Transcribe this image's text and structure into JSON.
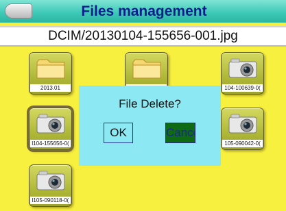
{
  "header": {
    "title": "Files management",
    "back_icon": "back-arrow-icon"
  },
  "path": {
    "text": "DCIM/20130104-155656-001.jpg"
  },
  "tiles": [
    {
      "label": "2013.01",
      "icon": "folder-icon"
    },
    {
      "label": "",
      "icon": "folder-icon"
    },
    {
      "label": "104-100639-0(",
      "icon": "camera-icon"
    },
    {
      "label": "l104-155656-0(",
      "icon": "camera-icon"
    },
    {
      "label": "105-090042-0(",
      "icon": "camera-icon"
    },
    {
      "label": "l105-090118-0(",
      "icon": "camera-icon"
    }
  ],
  "dialog": {
    "message": "File Delete?",
    "ok_label": "OK",
    "cancel_label": "Cancel"
  },
  "colors": {
    "background": "#f8f03e",
    "header": "#3fcab8",
    "title_text": "#0b1f8a",
    "dialog_bg": "#8ce8f2",
    "cancel_bg": "#0f6a14"
  }
}
